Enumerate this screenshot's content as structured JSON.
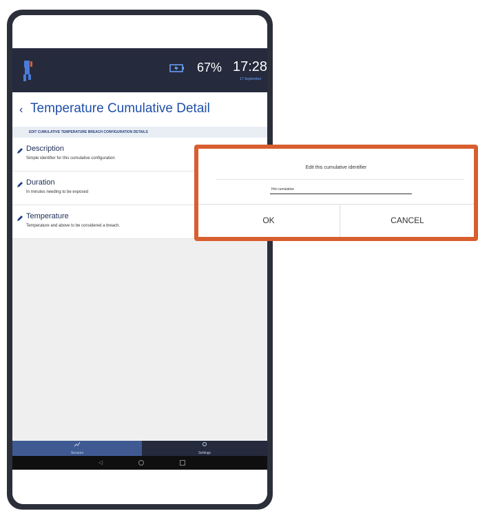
{
  "status": {
    "battery_percent": "67%",
    "clock": "17:28",
    "clock_sub": "17 September"
  },
  "header": {
    "title": "Temperature Cumulative Detail",
    "subheader": "EDIT CUMULATIVE TEMPERATURE BREACH CONFIGURATION DETAILS"
  },
  "items": [
    {
      "title": "Description",
      "subtitle": "Simple identifier for this cumulative configuration"
    },
    {
      "title": "Duration",
      "subtitle": "In minutes needing to be exposed"
    },
    {
      "title": "Temperature",
      "subtitle": "Temperature and above to be considered a breach."
    }
  ],
  "bottom_nav": {
    "sensors_label": "Sensors",
    "settings_label": "Settings"
  },
  "dialog": {
    "title": "Edit this cumulative identifier",
    "input_value": "Hot cumulative",
    "ok_label": "OK",
    "cancel_label": "CANCEL"
  },
  "colors": {
    "accent": "#1f4fa8",
    "status_bar": "#252b3d",
    "highlight_border": "#d85e2f"
  }
}
